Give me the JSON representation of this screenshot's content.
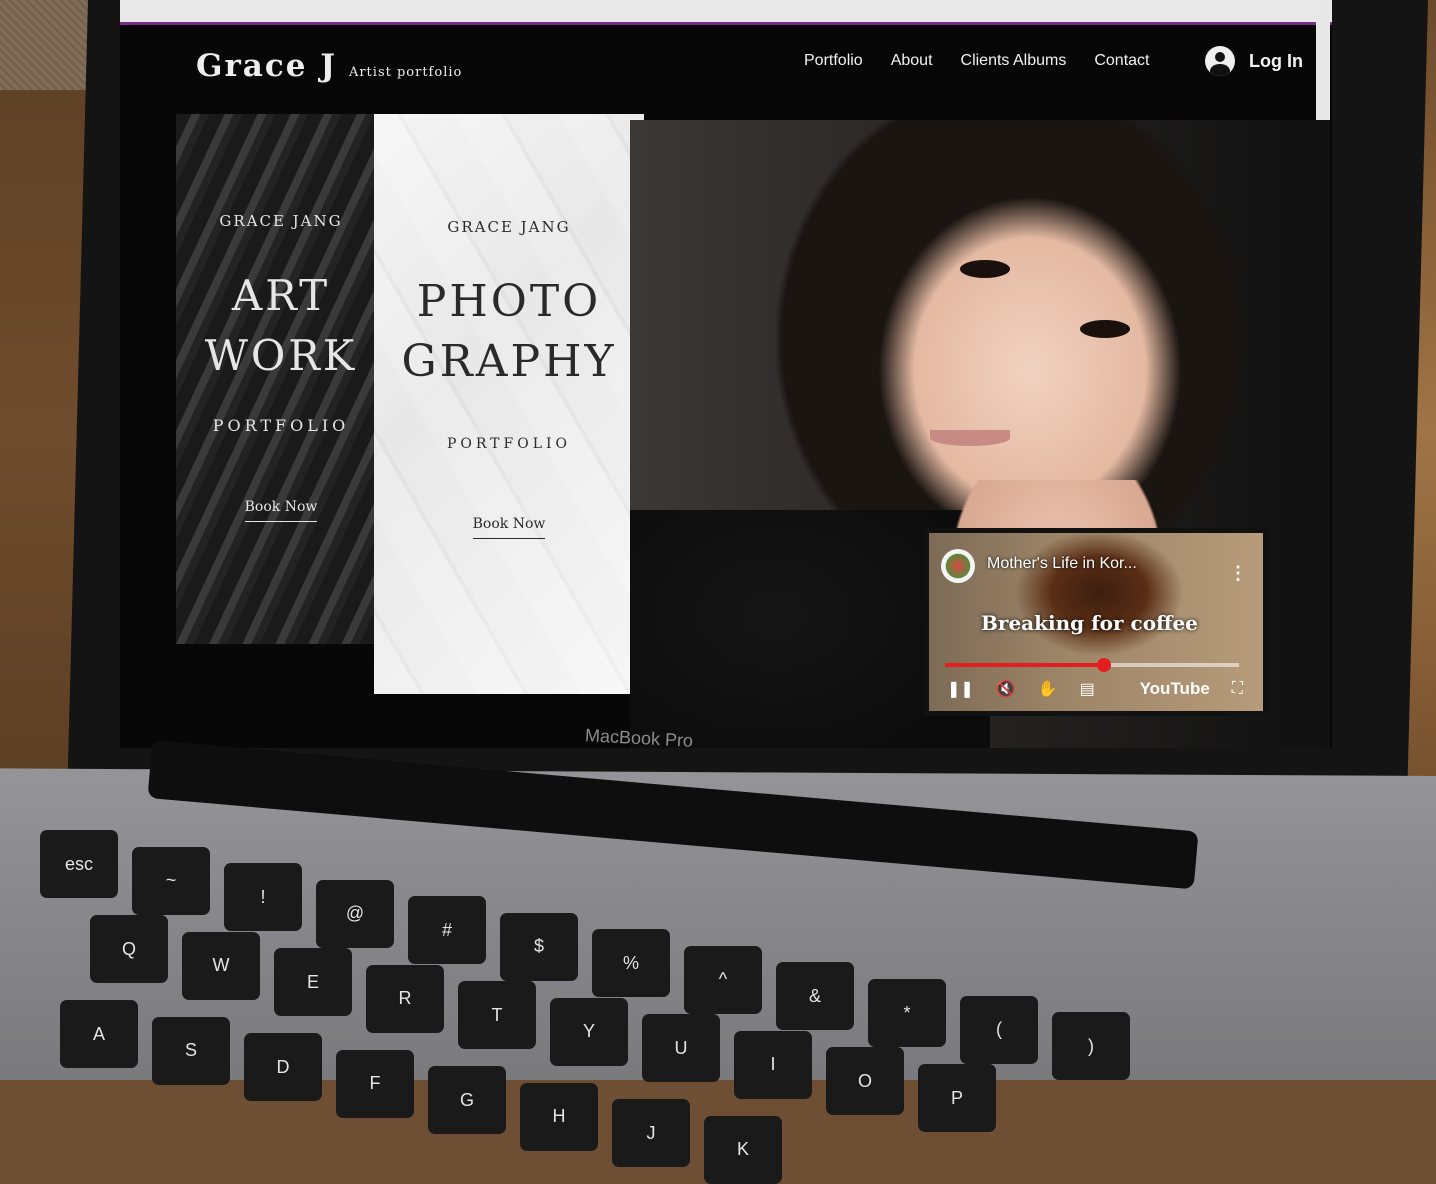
{
  "site": {
    "logo": "Grace J",
    "logo_subtitle": "Artist portfolio",
    "nav": [
      "Portfolio",
      "About",
      "Clients Albums",
      "Contact"
    ],
    "login": "Log In"
  },
  "cards": {
    "art": {
      "kicker": "GRACE JANG",
      "title_line1": "ART",
      "title_line2": "WORK",
      "subtitle": "PORTFOLIO",
      "cta": "Book Now"
    },
    "photo": {
      "kicker": "GRACE JANG",
      "title_line1": "PHOTO",
      "title_line2": "GRAPHY",
      "subtitle": "PORTFOLIO",
      "cta": "Book Now"
    }
  },
  "video": {
    "channel_title": "Mother's Life in Kor...",
    "caption": "Breaking for coffee",
    "progress": 0.54,
    "brand": "YouTube"
  },
  "device": {
    "label": "MacBook Pro"
  },
  "keyboard": {
    "keys": [
      "esc",
      "~",
      "!",
      "@",
      "#",
      "$",
      "%",
      "^",
      "&",
      "*",
      "(",
      ")",
      "Q",
      "W",
      "E",
      "R",
      "T",
      "Y",
      "U",
      "I",
      "O",
      "P",
      "A",
      "S",
      "D",
      "F",
      "G",
      "H",
      "J",
      "K"
    ]
  }
}
